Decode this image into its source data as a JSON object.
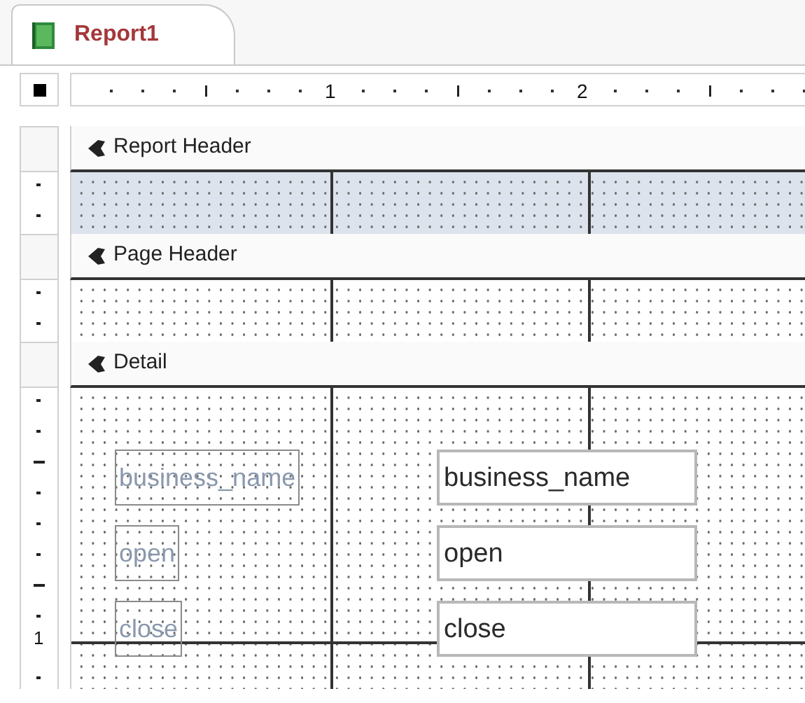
{
  "tab": {
    "label": "Report1",
    "selected": true
  },
  "ruler": {
    "labels": [
      "1",
      "2"
    ]
  },
  "sections": [
    {
      "title": "Report Header",
      "selected": true
    },
    {
      "title": "Page Header",
      "selected": false
    },
    {
      "title": "Detail",
      "selected": false,
      "ruler_labels": [
        "1"
      ],
      "rows": [
        {
          "label": "business_name",
          "textbox": "business_name"
        },
        {
          "label": "open",
          "textbox": "open"
        },
        {
          "label": "close",
          "textbox": "close"
        }
      ]
    }
  ]
}
